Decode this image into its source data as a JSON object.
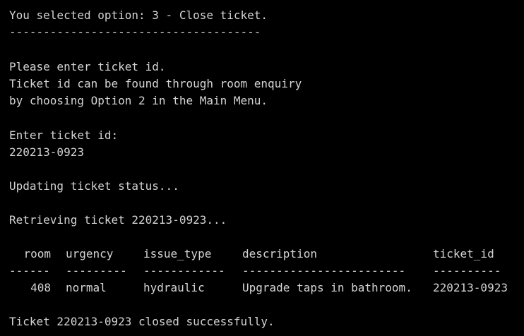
{
  "terminal": {
    "selected": "You selected option: 3 - Close ticket.",
    "separator": "-------------------------------------",
    "prompt1": "Please enter ticket id.",
    "prompt2": "Ticket id can be found through room enquiry",
    "prompt3": "by choosing Option 2 in the Main Menu.",
    "enter_label": "Enter ticket id:",
    "entered_value": "220213-0923",
    "updating": "Updating ticket status...",
    "retrieving": "Retrieving ticket 220213-0923...",
    "table": {
      "headers": [
        "room",
        "urgency",
        "issue_type",
        "description",
        "ticket_id"
      ],
      "dashes": [
        "------",
        "---------",
        "------------",
        "------------------------",
        "----------"
      ],
      "rows": [
        [
          "408",
          "normal",
          "hydraulic",
          "Upgrade taps in bathroom.",
          "220213-0923"
        ]
      ]
    },
    "result": "Ticket 220213-0923 closed successfully."
  }
}
